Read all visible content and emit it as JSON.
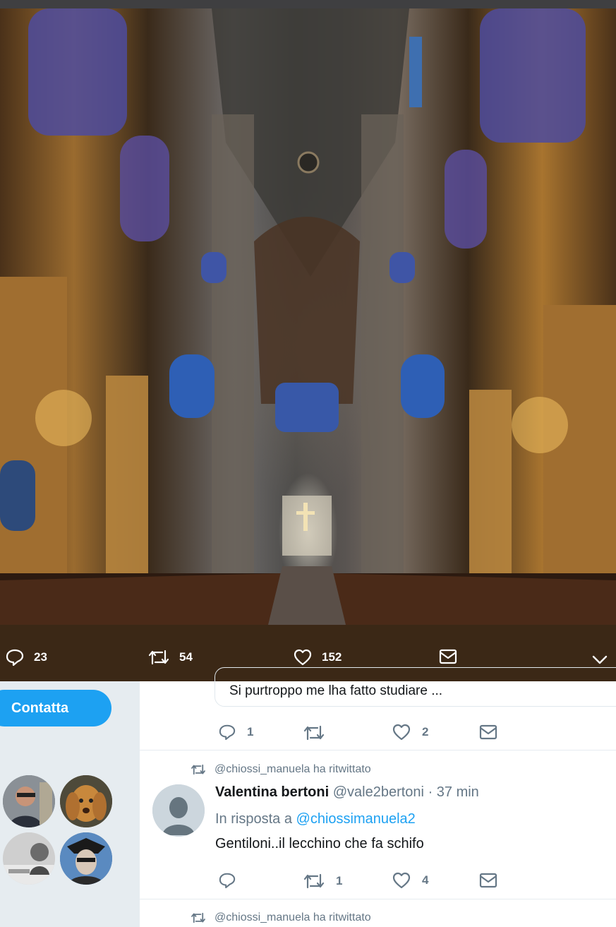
{
  "photo": {
    "description_icon": "cathedral-photo"
  },
  "photo_actions": {
    "replies": "23",
    "retweets": "54",
    "likes": "152"
  },
  "sidebar": {
    "contact_button": "Contatta"
  },
  "quoted_tweet": {
    "text": "Si purtroppo me lha fatto studiare ..."
  },
  "first_actions": {
    "replies": "1",
    "retweets": "",
    "likes": "2"
  },
  "tweet": {
    "retweet_note": "@chiossi_manuela ha ritwittato",
    "name": "Valentina bertoni",
    "handle": "@vale2bertoni",
    "time": "· 37 min",
    "reply_prefix": "In risposta a",
    "reply_to": "@chiossimanuela2",
    "text": "Gentiloni..il lecchino che fa schifo",
    "replies": "",
    "retweets": "1",
    "likes": "4"
  },
  "next_tweet": {
    "retweet_note": "@chiossi_manuela ha ritwittato"
  },
  "colors": {
    "accent": "#1da1f2",
    "action_bar": "#3b2816",
    "muted": "#657786"
  }
}
